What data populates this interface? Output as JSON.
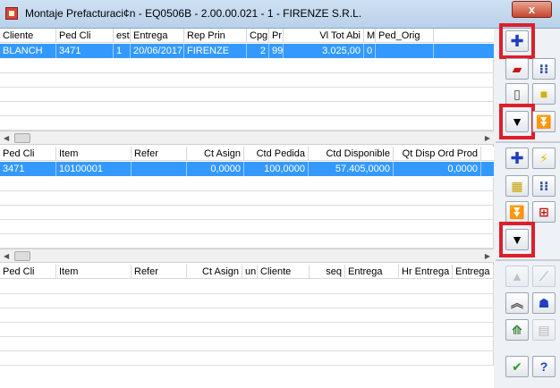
{
  "window": {
    "title": "Montaje Prefacturaci¢n - EQ0506B - 2.00.00.021 - 1 - FIRENZE S.R.L.",
    "close_label": "x"
  },
  "grid1": {
    "columns": [
      "Cliente",
      "Ped Cli",
      "est",
      "Entrega",
      "Rep Prin",
      "Cpg",
      "Pr",
      "Vl Tot Abi",
      "M",
      "Ped_Orig"
    ],
    "rows": [
      [
        "BLANCH",
        "3471",
        "1",
        "20/06/2017",
        "FIRENZE",
        "2",
        "99",
        "3.025,00",
        "0",
        ""
      ]
    ]
  },
  "grid2": {
    "columns": [
      "Ped Cli",
      "Item",
      "Refer",
      "Ct Asign",
      "Ctd Pedida",
      "Ctd Disponible",
      "Qt Disp Ord Prod"
    ],
    "rows": [
      [
        "3471",
        "10100001",
        "",
        "0,0000",
        "100,0000",
        "57.405,0000",
        "0,0000"
      ]
    ]
  },
  "grid3": {
    "columns": [
      "Ped Cli",
      "Item",
      "Refer",
      "Ct Asign",
      "un",
      "Cliente",
      "seq",
      "Entrega",
      "Hr Entrega",
      "Entrega"
    ],
    "rows": []
  },
  "toolbar": {
    "icons": [
      "plus-icon",
      "tag-icon",
      "stack-icon",
      "grid-icon",
      "new-doc-icon",
      "note-icon",
      "down-arrow-icon",
      "step-down-icon",
      "plus-icon",
      "lightning-icon",
      "building-icon",
      "grid-icon",
      "step-down-icon",
      "tree-icon",
      "down-arrow-icon",
      "up-arrow-icon",
      "line-icon",
      "double-up-icon",
      "user-icon",
      "chart-icon",
      "table-icon",
      "check-icon",
      "help-icon"
    ],
    "help_label": "?",
    "check_label": "✔"
  },
  "colors": {
    "selection": "#3399ff",
    "highlight": "#dd1f2b"
  }
}
